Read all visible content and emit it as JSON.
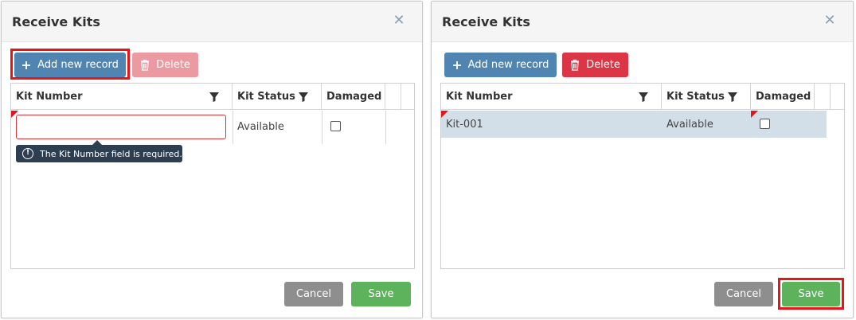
{
  "colors": {
    "primary": "#4f85b0",
    "danger": "#dc3545",
    "success": "#5cb35c",
    "neutral": "#8e8e8e",
    "highlight": "#e8141a",
    "tooltip_bg": "#2c3e50",
    "row_selected": "#d3dfe8"
  },
  "left": {
    "title": "Receive Kits",
    "add_label": "Add new record",
    "delete_label": "Delete",
    "columns": [
      "Kit Number",
      "Kit Status",
      "Damaged"
    ],
    "row": {
      "kit_number": "",
      "kit_status": "Available",
      "damaged": false
    },
    "validation_message": "The Kit Number field is required.",
    "cancel_label": "Cancel",
    "save_label": "Save"
  },
  "right": {
    "title": "Receive Kits",
    "add_label": "Add new record",
    "delete_label": "Delete",
    "columns": [
      "Kit Number",
      "Kit Status",
      "Damaged"
    ],
    "row": {
      "kit_number": "Kit-001",
      "kit_status": "Available",
      "damaged": false
    },
    "cancel_label": "Cancel",
    "save_label": "Save"
  }
}
